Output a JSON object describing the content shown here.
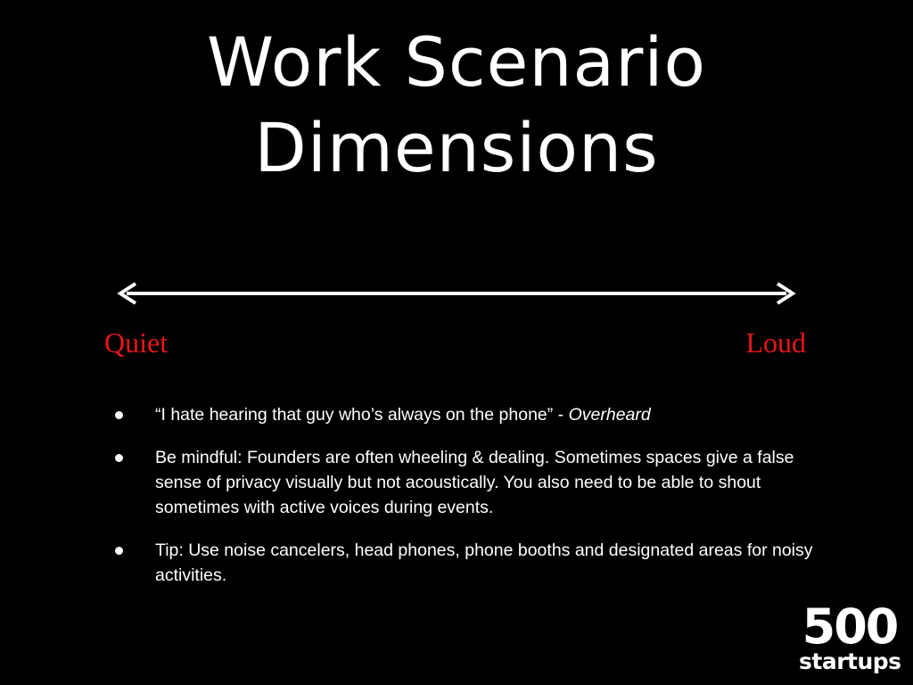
{
  "slide": {
    "title_line1": "Work Scenario",
    "title_line2": "Dimensions",
    "scale": {
      "left_label": "Quiet",
      "right_label": "Loud",
      "label_color": "#e8161c",
      "arrow_color": "#ffffff"
    },
    "bullets": [
      {
        "text": "“I hate hearing that guy who’s always on the phone” - ",
        "emphasis": "Overheard"
      },
      {
        "text": "Be mindful:  Founders are often wheeling & dealing. Sometimes spaces give a false sense of privacy visually but not acoustically. You also need to be able to shout sometimes with active voices during events.",
        "emphasis": ""
      },
      {
        "text": "Tip: Use noise cancelers, head phones, phone booths and designated areas for noisy activities.",
        "emphasis": ""
      }
    ],
    "logo": {
      "number": "500",
      "word": "startups"
    },
    "background_color": "#000000"
  }
}
